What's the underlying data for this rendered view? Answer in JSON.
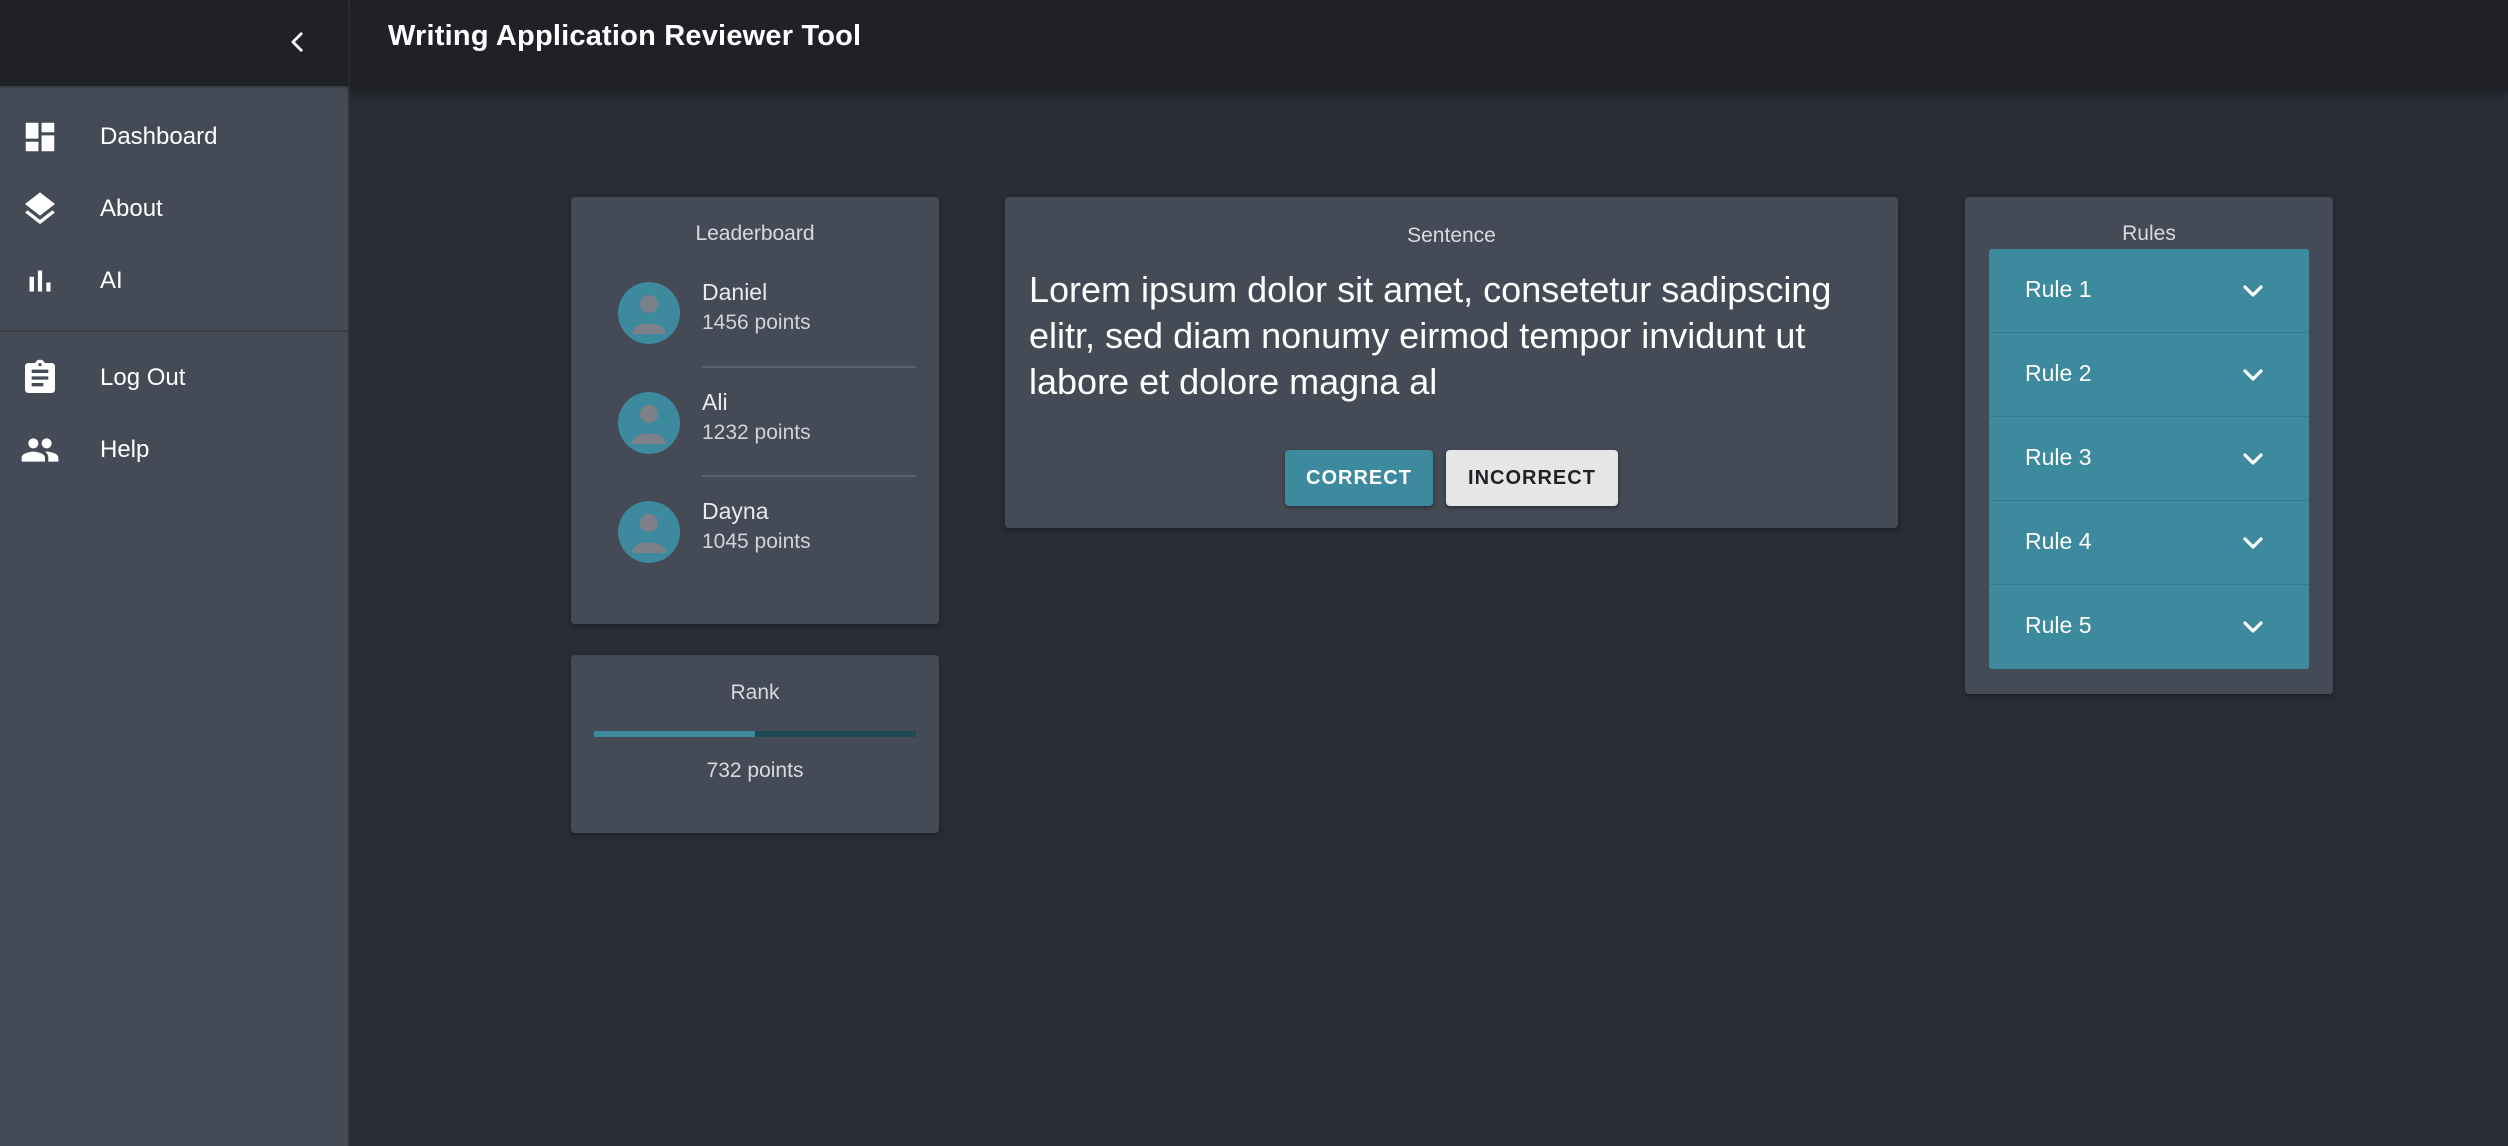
{
  "app": {
    "title": "Writing Application Reviewer Tool"
  },
  "sidebar": {
    "items": [
      {
        "label": "Dashboard",
        "icon": "dashboard-icon"
      },
      {
        "label": "About",
        "icon": "layers-icon"
      },
      {
        "label": "AI",
        "icon": "bar-chart-icon"
      },
      {
        "label": "Log Out",
        "icon": "clipboard-icon"
      },
      {
        "label": "Help",
        "icon": "people-icon"
      }
    ]
  },
  "leaderboard": {
    "title": "Leaderboard",
    "entries": [
      {
        "name": "Daniel",
        "points": "1456 points"
      },
      {
        "name": "Ali",
        "points": "1232 points"
      },
      {
        "name": "Dayna",
        "points": "1045 points"
      }
    ]
  },
  "rank": {
    "title": "Rank",
    "points": "732 points",
    "progress": 0.5
  },
  "sentence": {
    "title": "Sentence",
    "text": "Lorem ipsum dolor sit amet, consetetur sadipscing elitr, sed diam nonumy eirmod tempor invidunt ut labore et dolore magna al",
    "correct_label": "CORRECT",
    "incorrect_label": "INCORRECT"
  },
  "rules": {
    "title": "Rules",
    "items": [
      {
        "label": "Rule 1"
      },
      {
        "label": "Rule 2"
      },
      {
        "label": "Rule 3"
      },
      {
        "label": "Rule 4"
      },
      {
        "label": "Rule 5"
      }
    ]
  },
  "colors": {
    "accent": "#3d8a9e",
    "background": "#2a2d36",
    "card": "#444a56",
    "topbar": "#1f2126"
  }
}
